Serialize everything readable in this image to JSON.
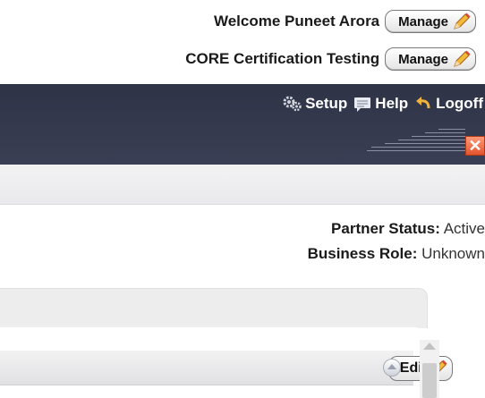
{
  "user": {
    "welcome_text": "Welcome Puneet Arora",
    "org_name": "CORE Certification Testing",
    "manage_label": "Manage"
  },
  "nav": {
    "setup": "Setup",
    "help": "Help",
    "logoff": "Logoff"
  },
  "status": {
    "partner_label": "Partner Status:",
    "partner_value": "Active",
    "role_label": "Business Role:",
    "role_value": "Unknown"
  },
  "section": {
    "edit_label": "Edit"
  },
  "colors": {
    "navbar": "#34384c",
    "close": "#e2542c"
  },
  "icons": [
    "pencil-icon",
    "gear-icon",
    "help-icon",
    "logoff-icon",
    "close-icon",
    "collapse-icon"
  ]
}
